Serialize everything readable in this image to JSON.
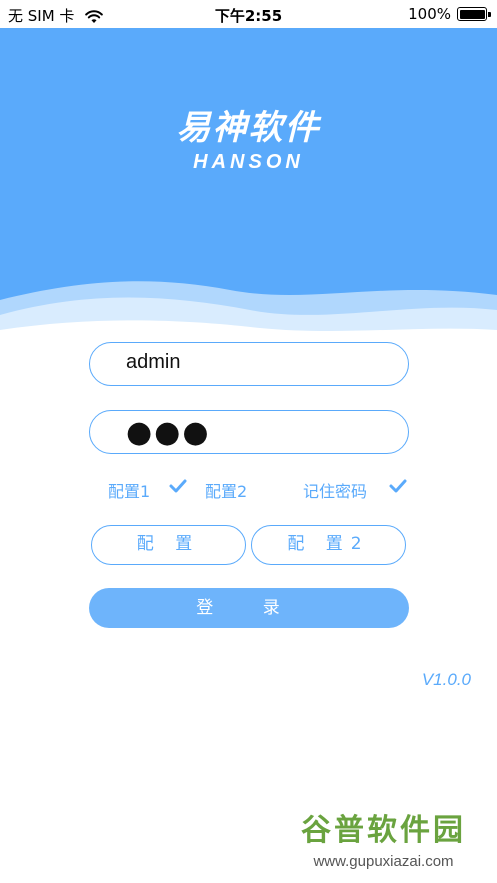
{
  "status_bar": {
    "carrier": "无 SIM 卡",
    "time": "下午2:55",
    "battery": "100%",
    "wifi_icon": "wifi-icon",
    "battery_icon": "battery-icon"
  },
  "logo": {
    "cn": "易神软件",
    "en": "HANSON"
  },
  "form": {
    "username": "admin",
    "password_mask": "●●●"
  },
  "options": {
    "config1": "配置1",
    "config2": "配置2",
    "remember": "记住密码",
    "config1_checked": true,
    "config2_checked": false,
    "remember_checked": true
  },
  "buttons": {
    "config": "配 置",
    "config2": "配 置2",
    "login": "登 录"
  },
  "version": "V1.0.0",
  "watermark": {
    "cn": "谷普软件园",
    "url": "www.gupuxiazai.com"
  },
  "colors": {
    "accent": "#5aaafb",
    "login_bg": "#6eb4fb"
  }
}
